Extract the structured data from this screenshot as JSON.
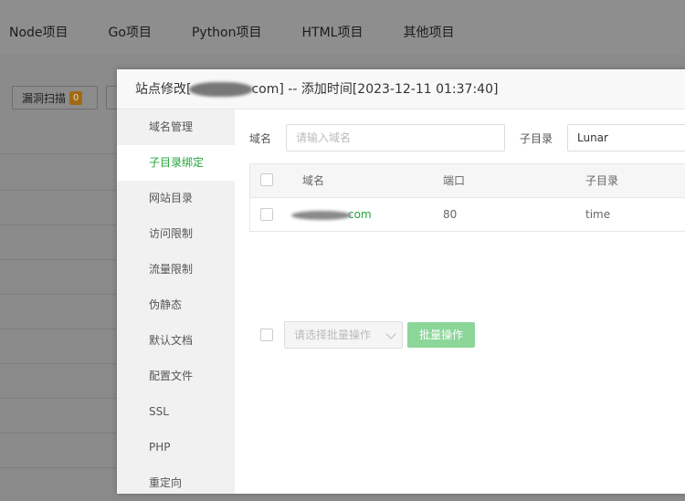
{
  "background": {
    "tabs": [
      "Node项目",
      "Go项目",
      "Python项目",
      "HTML项目",
      "其他项目"
    ],
    "scan_button": {
      "label": "漏洞扫描",
      "count": "0"
    }
  },
  "modal": {
    "title_prefix": "站点修改[",
    "title_suffix": "com] -- 添加时间[2023-12-11 01:37:40]",
    "sidebar": [
      "域名管理",
      "子目录绑定",
      "网站目录",
      "访问限制",
      "流量限制",
      "伪静态",
      "默认文档",
      "配置文件",
      "SSL",
      "PHP",
      "重定向"
    ],
    "active_sidebar_index": 1,
    "form": {
      "domain_label": "域名",
      "domain_placeholder": "请输入域名",
      "subdir_label": "子目录",
      "subdir_value": "Lunar"
    },
    "table": {
      "headers": [
        "域名",
        "端口",
        "子目录"
      ],
      "rows": [
        {
          "domain_suffix": "com",
          "port": "80",
          "subdir": "time"
        }
      ]
    },
    "batch": {
      "select_placeholder": "请选择批量操作",
      "button_label": "批量操作"
    }
  },
  "colors": {
    "accent": "#20a53a",
    "accent_disabled": "#8cd69a",
    "badge": "#a06b14"
  }
}
